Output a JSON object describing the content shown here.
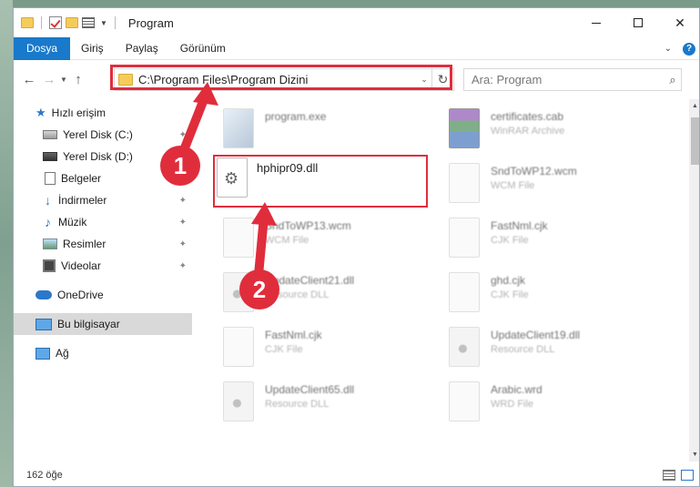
{
  "titlebar": {
    "title": "Program"
  },
  "ribbon": {
    "tabs": [
      "Dosya",
      "Giriş",
      "Paylaş",
      "Görünüm"
    ],
    "help_label": "?"
  },
  "nav": {
    "address": "C:\\Program Files\\Program Dizini",
    "search_placeholder": "Ara: Program"
  },
  "sidebar": {
    "items": [
      {
        "label": "Hızlı erişim",
        "icon": "star-icon"
      },
      {
        "label": "Yerel Disk (C:)",
        "icon": "drive-icon"
      },
      {
        "label": "Yerel Disk (D:)",
        "icon": "drive-icon"
      },
      {
        "label": "Belgeler",
        "icon": "documents-icon"
      },
      {
        "label": "İndirmeler",
        "icon": "downloads-icon"
      },
      {
        "label": "Müzik",
        "icon": "music-icon"
      },
      {
        "label": "Resimler",
        "icon": "pictures-icon"
      },
      {
        "label": "Videolar",
        "icon": "videos-icon"
      },
      {
        "label": "OneDrive",
        "icon": "onedrive-icon"
      },
      {
        "label": "Bu bilgisayar",
        "icon": "pc-icon"
      },
      {
        "label": "Ağ",
        "icon": "network-icon"
      }
    ]
  },
  "files": {
    "selected": {
      "name": "hphipr09.dll"
    },
    "items": [
      {
        "name": "program.exe",
        "type": ""
      },
      {
        "name": "certificates.cab",
        "type": "WinRAR Archive"
      },
      {
        "name": "SndToWP12.wcm",
        "type": "WCM File"
      },
      {
        "name": "SndToWP13.wcm",
        "type": "WCM File"
      },
      {
        "name": "FastNml.cjk",
        "type": "CJK File"
      },
      {
        "name": "UpdateClient21.dll",
        "type": "Resource DLL"
      },
      {
        "name": "ghd.cjk",
        "type": "CJK File"
      },
      {
        "name": "FastNml.cjk",
        "type": "CJK File"
      },
      {
        "name": "UpdateClient19.dll",
        "type": "Resource DLL"
      },
      {
        "name": "UpdateClient65.dll",
        "type": "Resource DLL"
      },
      {
        "name": "Arabic.wrd",
        "type": "WRD File"
      }
    ]
  },
  "status": {
    "count": "162 öğe"
  },
  "annotations": {
    "step1": "1",
    "step2": "2",
    "color": "#e02d3c"
  }
}
